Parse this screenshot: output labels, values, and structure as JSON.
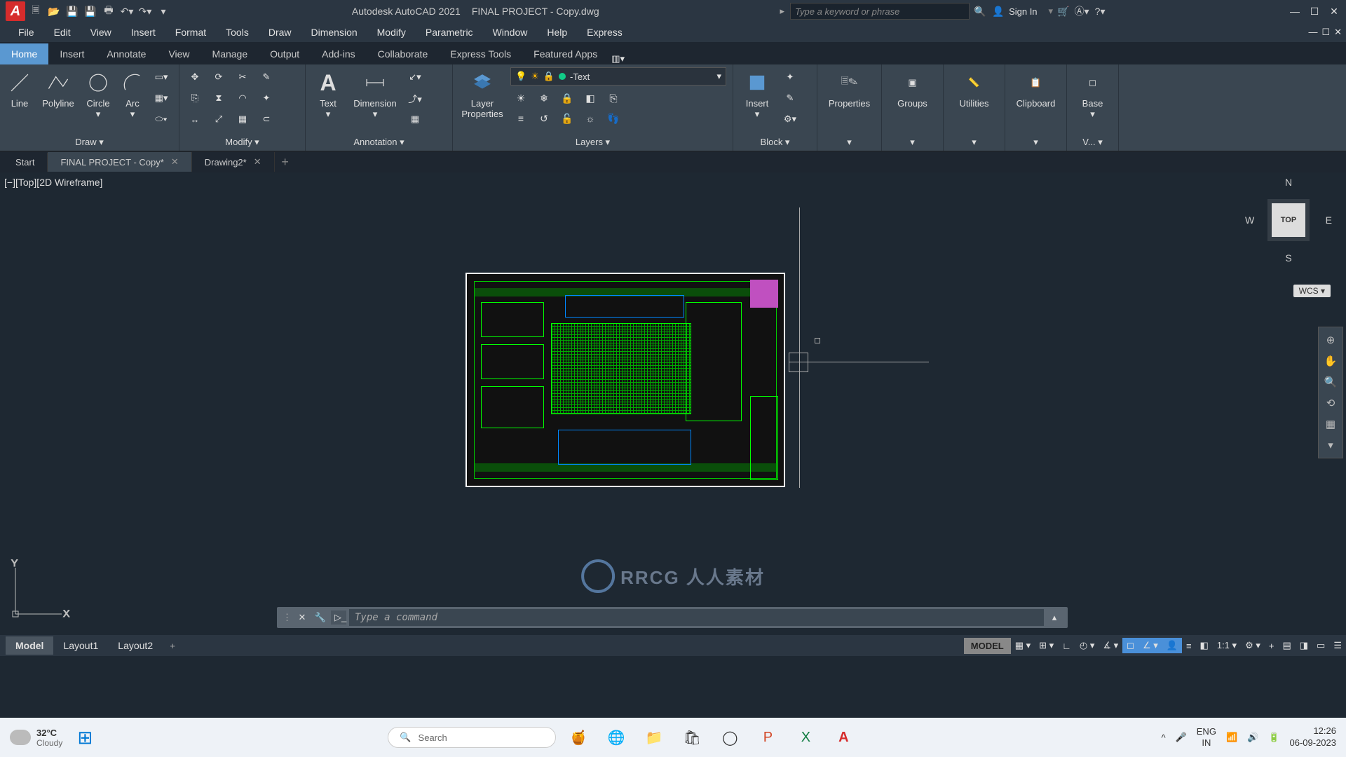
{
  "title": {
    "app": "Autodesk AutoCAD 2021",
    "file": "FINAL PROJECT - Copy.dwg"
  },
  "search": {
    "placeholder": "Type a keyword or phrase"
  },
  "signin": "Sign In",
  "menu": [
    "File",
    "Edit",
    "View",
    "Insert",
    "Format",
    "Tools",
    "Draw",
    "Dimension",
    "Modify",
    "Parametric",
    "Window",
    "Help",
    "Express"
  ],
  "ribbon_tabs": [
    "Home",
    "Insert",
    "Annotate",
    "View",
    "Manage",
    "Output",
    "Add-ins",
    "Collaborate",
    "Express Tools",
    "Featured Apps"
  ],
  "active_ribbon_tab": "Home",
  "panels": {
    "draw": {
      "title": "Draw ▾",
      "tools": [
        "Line",
        "Polyline",
        "Circle",
        "Arc"
      ]
    },
    "modify": {
      "title": "Modify ▾"
    },
    "annotation": {
      "title": "Annotation ▾",
      "text": "Text",
      "dimension": "Dimension"
    },
    "layers": {
      "title": "Layers ▾",
      "prop": "Layer\nProperties",
      "current": "-Text"
    },
    "block": {
      "title": "Block ▾",
      "insert": "Insert"
    },
    "properties": "Properties",
    "groups": "Groups",
    "utilities": "Utilities",
    "clipboard": "Clipboard",
    "view": {
      "title": "V... ▾",
      "base": "Base"
    }
  },
  "file_tabs": [
    {
      "label": "Start",
      "active": false,
      "closeable": false
    },
    {
      "label": "FINAL PROJECT - Copy*",
      "active": true,
      "closeable": true
    },
    {
      "label": "Drawing2*",
      "active": false,
      "closeable": true
    }
  ],
  "viewport_label": "[−][Top][2D Wireframe]",
  "viewcube": {
    "face": "TOP",
    "n": "N",
    "s": "S",
    "e": "E",
    "w": "W",
    "wcs": "WCS"
  },
  "ucs": {
    "x": "X",
    "y": "Y"
  },
  "cmd": {
    "placeholder": "Type a command"
  },
  "layout_tabs": [
    "Model",
    "Layout1",
    "Layout2"
  ],
  "active_layout": "Model",
  "status": {
    "model": "MODEL",
    "scale": "1:1"
  },
  "taskbar": {
    "weather": {
      "temp": "32°C",
      "desc": "Cloudy"
    },
    "search": "Search",
    "lang": {
      "top": "ENG",
      "bot": "IN"
    },
    "time": {
      "top": "12:26",
      "bot": "06-09-2023"
    }
  },
  "watermark": "RRCG 人人素材"
}
